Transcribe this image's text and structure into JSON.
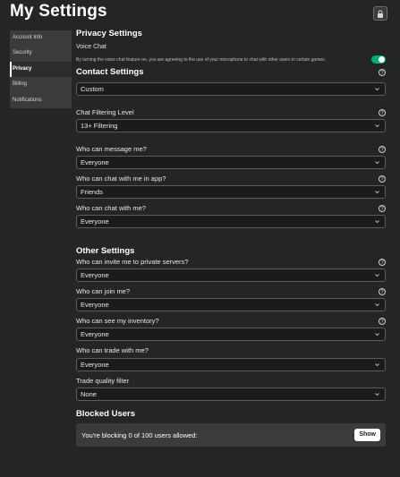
{
  "header": {
    "title": "My Settings",
    "lock_icon": "lock-icon"
  },
  "sidebar": {
    "items": [
      {
        "label": "Account Info",
        "active": false
      },
      {
        "label": "Security",
        "active": false
      },
      {
        "label": "Privacy",
        "active": true
      },
      {
        "label": "Billing",
        "active": false
      },
      {
        "label": "Notifications",
        "active": false
      }
    ]
  },
  "privacy": {
    "title": "Privacy Settings",
    "voice_chat_label": "Voice Chat",
    "voice_chat_desc": "By turning the voice chat feature on, you are agreeing to the use of your microphone to chat with other users in certain games.",
    "voice_chat_enabled": true
  },
  "contact": {
    "title": "Contact Settings",
    "preset_value": "Custom",
    "filter_label": "Chat Filtering Level",
    "filter_value": "13+ Filtering",
    "message_label": "Who can message me?",
    "message_value": "Everyone",
    "chat_app_label": "Who can chat with me in app?",
    "chat_app_value": "Friends",
    "chat_label": "Who can chat with me?",
    "chat_value": "Everyone"
  },
  "other": {
    "title": "Other Settings",
    "invite_label": "Who can invite me to private servers?",
    "invite_value": "Everyone",
    "join_label": "Who can join me?",
    "join_value": "Everyone",
    "inventory_label": "Who can see my inventory?",
    "inventory_value": "Everyone",
    "trade_label": "Who can trade with me?",
    "trade_value": "Everyone",
    "trade_filter_label": "Trade quality filter",
    "trade_filter_value": "None"
  },
  "blocked": {
    "title": "Blocked Users",
    "status_text": "You're blocking 0 of 100 users allowed:",
    "show_label": "Show"
  },
  "colors": {
    "background": "#232527",
    "toggle_on": "#00b06f",
    "panel": "#393b3d"
  }
}
